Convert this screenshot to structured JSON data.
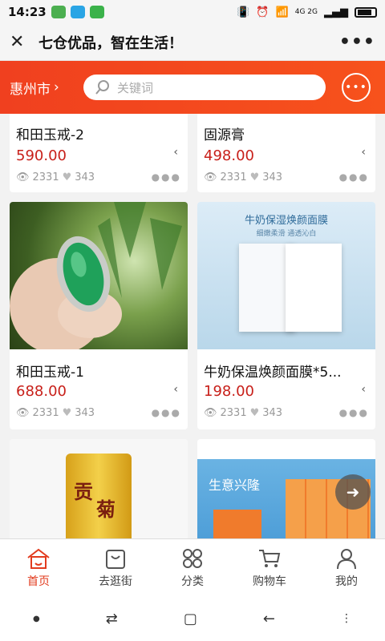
{
  "status_bar": {
    "time": "14:23",
    "network": "4G 2G"
  },
  "top_bar": {
    "title": "七仓优品，智在生活！",
    "close_icon": "close-icon",
    "more_icon": "more-icon"
  },
  "header": {
    "city": "惠州市",
    "search_placeholder": "关键词"
  },
  "products": [
    {
      "name": "和田玉戒-2",
      "price": "590.00",
      "views": "2331",
      "likes": "343"
    },
    {
      "name": "固源膏",
      "price": "498.00",
      "views": "2331",
      "likes": "343"
    },
    {
      "name": "和田玉戒-1",
      "price": "688.00",
      "views": "2331",
      "likes": "343"
    },
    {
      "name": "牛奶保温焕颜面膜*5...",
      "price": "198.00",
      "views": "2331",
      "likes": "343",
      "image_text": [
        "牛奶保湿焕颜面膜",
        "细嫩柔滑  通透沁白"
      ]
    },
    {
      "image_text": [
        "贡",
        "菊"
      ]
    },
    {
      "image_text": [
        "生意兴隆"
      ]
    }
  ],
  "bottom_nav": [
    {
      "label": "首页",
      "active": true
    },
    {
      "label": "去逛街"
    },
    {
      "label": "分类"
    },
    {
      "label": "购物车"
    },
    {
      "label": "我的"
    }
  ],
  "colors": {
    "accent": "#f0401f",
    "price": "#c8201a"
  }
}
